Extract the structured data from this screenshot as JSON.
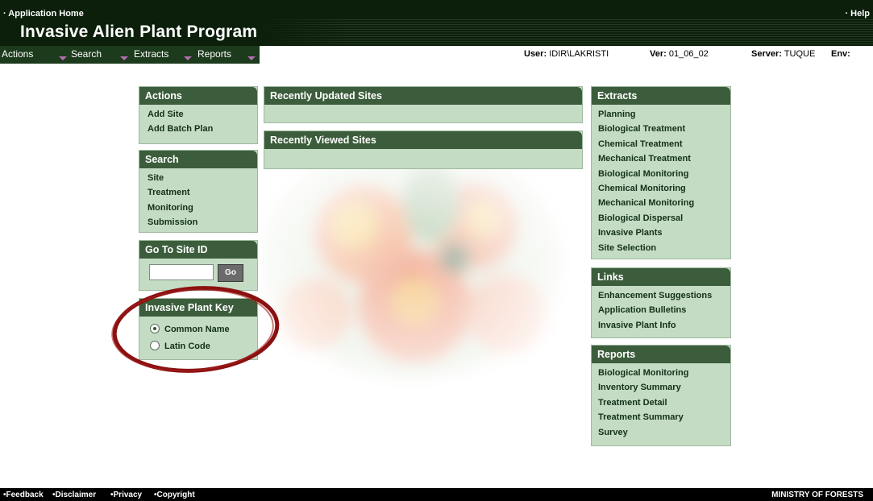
{
  "header": {
    "home_link": "· Application Home",
    "help_link": "· Help",
    "title": "Invasive Alien Plant Program"
  },
  "menu": {
    "items": [
      {
        "label": "Actions"
      },
      {
        "label": "Search"
      },
      {
        "label": "Extracts"
      },
      {
        "label": "Reports"
      }
    ]
  },
  "info": {
    "user_label": "User:",
    "user_value": "IDIR\\LAKRISTI",
    "ver_label": "Ver:",
    "ver_value": "01_06_02",
    "server_label": "Server:",
    "server_value": "TUQUE",
    "env_label": "Env:"
  },
  "actions": {
    "title": "Actions",
    "items": [
      "Add Site",
      "Add Batch Plan"
    ]
  },
  "search": {
    "title": "Search",
    "items": [
      "Site",
      "Treatment",
      "Monitoring",
      "Submission"
    ]
  },
  "goto": {
    "title": "Go To Site ID",
    "input_value": "",
    "button": "Go"
  },
  "plant_key": {
    "title": "Invasive Plant Key",
    "options": [
      {
        "label": "Common Name",
        "selected": true
      },
      {
        "label": "Latin Code",
        "selected": false
      }
    ]
  },
  "recent_updated": {
    "title": "Recently Updated Sites"
  },
  "recent_viewed": {
    "title": "Recently Viewed Sites"
  },
  "extracts": {
    "title": "Extracts",
    "items": [
      "Planning",
      "Biological Treatment",
      "Chemical Treatment",
      "Mechanical Treatment",
      "Biological Monitoring",
      "Chemical Monitoring",
      "Mechanical Monitoring",
      "Biological Dispersal",
      "Invasive Plants",
      "Site Selection"
    ]
  },
  "links": {
    "title": "Links",
    "items": [
      "Enhancement Suggestions",
      "Application Bulletins",
      "Invasive Plant Info"
    ]
  },
  "reports": {
    "title": "Reports",
    "items": [
      "Biological Monitoring",
      "Inventory Summary",
      "Treatment Detail",
      "Treatment Summary",
      "Survey"
    ]
  },
  "footer": {
    "links": [
      "•Feedback",
      "•Disclaimer",
      "•Privacy",
      "•Copyright"
    ],
    "ministry": "MINISTRY OF FORESTS"
  },
  "colors": {
    "header_bg": "#0b1f0b",
    "panel_header": "#3c5d3c",
    "panel_body": "#c4dcc4",
    "highlight_ring": "#8b1010"
  }
}
